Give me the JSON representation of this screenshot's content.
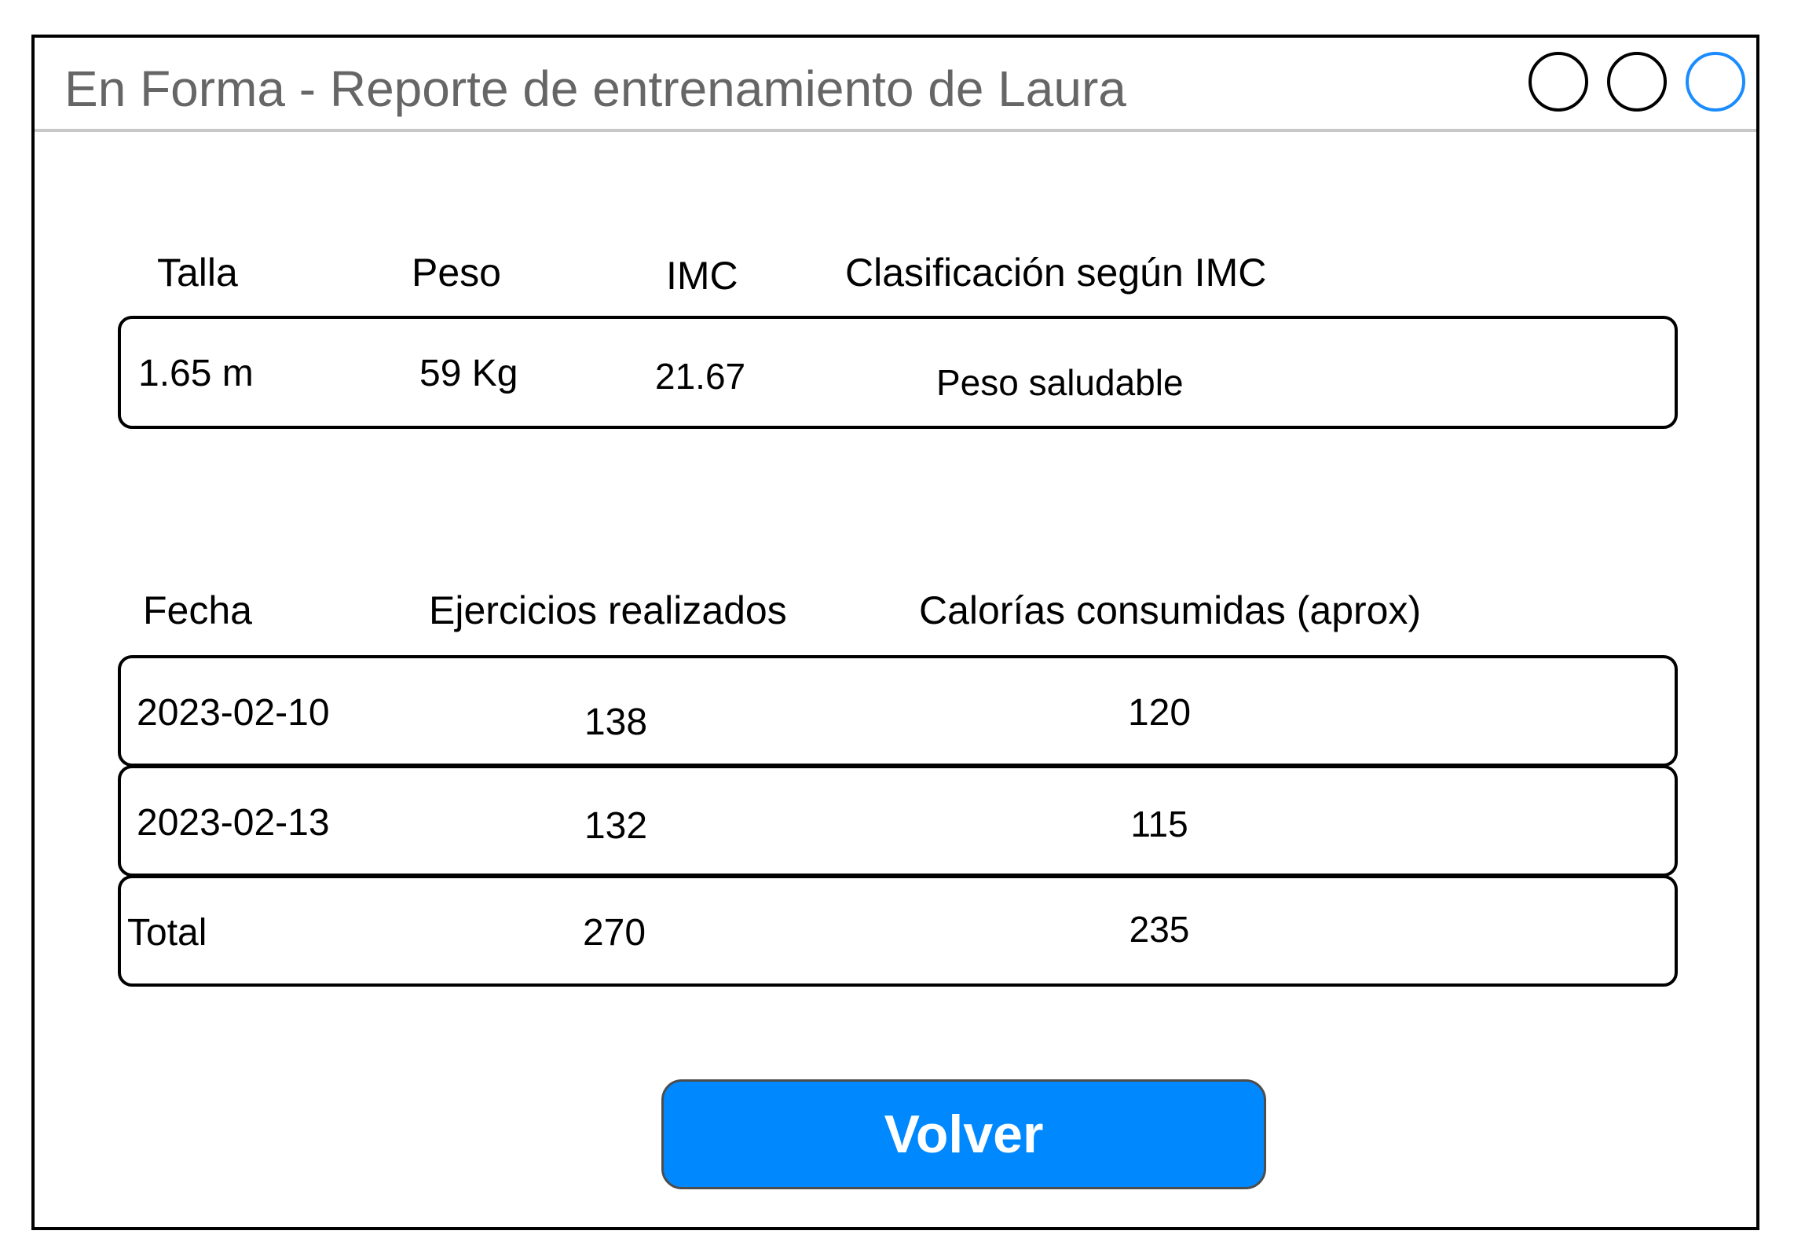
{
  "window": {
    "title": "En Forma - Reporte de entrenamiento de Laura",
    "controls": [
      "circle-button",
      "circle-button",
      "circle-button"
    ],
    "active_control_color": "#1a8cff"
  },
  "metrics": {
    "headers": {
      "talla": "Talla",
      "peso": "Peso",
      "imc": "IMC",
      "clasificacion": "Clasificación según IMC"
    },
    "values": {
      "talla": "1.65 m",
      "peso": "59 Kg",
      "imc": "21.67",
      "clasificacion": "Peso saludable"
    }
  },
  "log": {
    "headers": {
      "fecha": "Fecha",
      "ejercicios": "Ejercicios realizados",
      "calorias": "Calorías consumidas (aprox)"
    },
    "rows": [
      {
        "fecha": "2023-02-10",
        "ejercicios": "138",
        "calorias": "120"
      },
      {
        "fecha": "2023-02-13",
        "ejercicios": "132",
        "calorias": "115"
      },
      {
        "fecha": "Total",
        "ejercicios": "270",
        "calorias": "235"
      }
    ]
  },
  "actions": {
    "volver_label": "Volver",
    "volver_color": "#0088ff"
  }
}
